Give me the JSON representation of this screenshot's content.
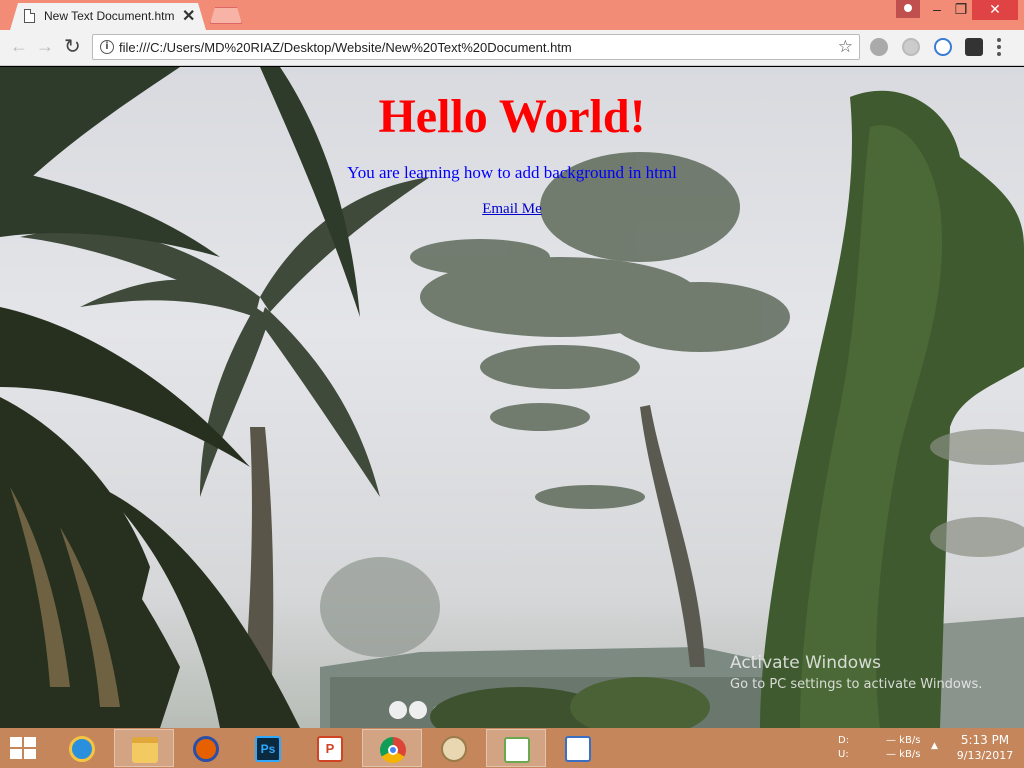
{
  "browser": {
    "tab_title": "New Text Document.htm",
    "tab_close": "✕",
    "url": "file:///C:/Users/MD%20RIAZ/Desktop/Website/New%20Text%20Document.htm",
    "back_icon": "←",
    "forward_icon": "→",
    "reload_icon": "↻",
    "star_icon": "☆",
    "window_min": "–",
    "window_max": "❐",
    "window_close": "✕"
  },
  "page": {
    "heading": "Hello World!",
    "subtitle": "You are learning how to add background in html",
    "link_text": "Email Me",
    "heading_color": "#ff0000",
    "text_color": "#0000ff"
  },
  "watermark": {
    "line1": "Activate Windows",
    "line2": "Go to PC settings to activate Windows."
  },
  "taskbar": {
    "apps": [
      "Windows Start",
      "Internet Explorer",
      "File Explorer",
      "Firefox",
      "Photoshop",
      "PowerPoint",
      "Chrome",
      "Paint",
      "Notepad",
      "Tool"
    ],
    "net_d_label": "D:",
    "net_u_label": "U:",
    "net_d_value": "— kB/s",
    "net_u_value": "— kB/s",
    "tray_arrow": "▲",
    "time": "5:13 PM",
    "date": "9/13/2017"
  }
}
